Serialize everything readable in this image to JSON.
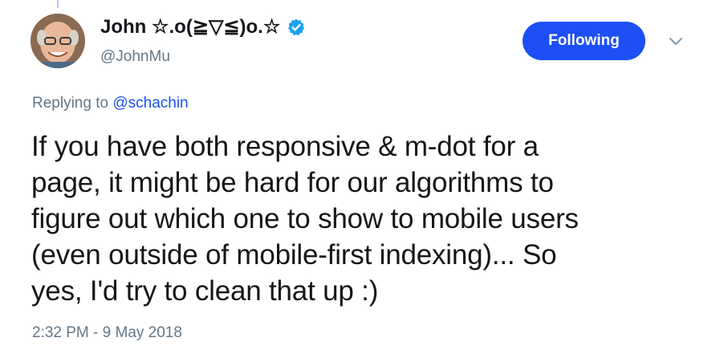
{
  "author": {
    "display_name": "John ☆.o(≧▽≦)o.☆",
    "handle": "@JohnMu",
    "verified_icon": "verified-badge-icon",
    "verified_color": "#1da1f2"
  },
  "follow_button": {
    "label": "Following",
    "color": "#1c4ff5"
  },
  "menu": {
    "icon": "chevron-down-icon"
  },
  "reply": {
    "prefix": "Replying to ",
    "mention": "@schachin"
  },
  "tweet": {
    "lines": [
      "If you have both responsive & m-dot for a",
      "page, it might be hard for our algorithms to",
      "figure out which one to show to mobile users",
      "(even outside of mobile-first indexing)... So",
      "yes, I'd try to clean that up :)"
    ]
  },
  "timestamp": "2:32 PM - 9 May 2018"
}
